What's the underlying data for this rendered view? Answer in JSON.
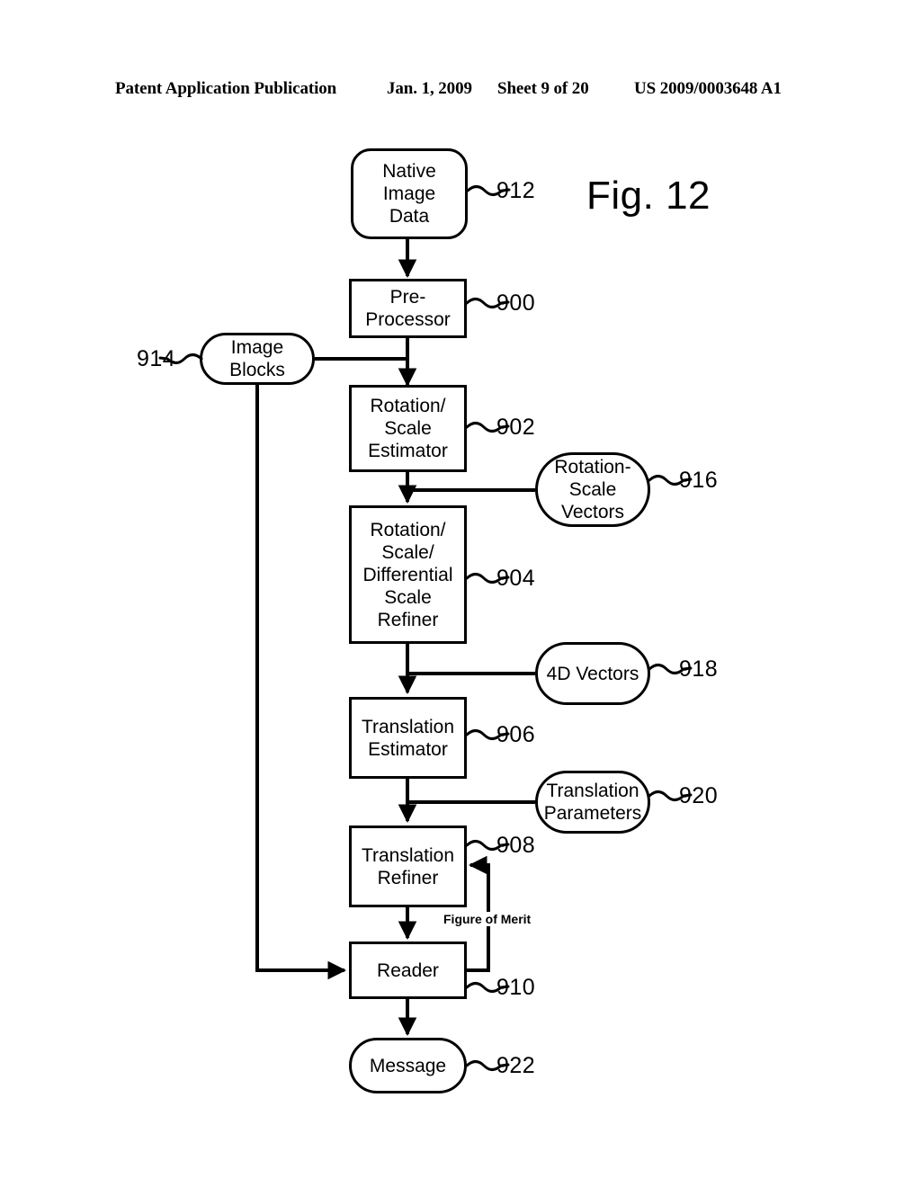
{
  "header": {
    "publication": "Patent Application Publication",
    "date": "Jan. 1, 2009",
    "sheet": "Sheet 9 of 20",
    "patent_number": "US 2009/0003648 A1"
  },
  "figure": {
    "title": "Fig. 12",
    "caption_edge_label": "Figure of Merit"
  },
  "nodes": [
    {
      "id": "n912",
      "ref": "912",
      "label": "Native\nImage\nData",
      "shape": "round"
    },
    {
      "id": "n900",
      "ref": "900",
      "label": "Pre-\nProcessor",
      "shape": "rect"
    },
    {
      "id": "n914",
      "ref": "914",
      "label": "Image\nBlocks",
      "shape": "stadium"
    },
    {
      "id": "n902",
      "ref": "902",
      "label": "Rotation/\nScale\nEstimator",
      "shape": "rect"
    },
    {
      "id": "n916",
      "ref": "916",
      "label": "Rotation-\nScale\nVectors",
      "shape": "stadium"
    },
    {
      "id": "n904",
      "ref": "904",
      "label": "Rotation/\nScale/\nDifferential\nScale\nRefiner",
      "shape": "rect"
    },
    {
      "id": "n918",
      "ref": "918",
      "label": "4D Vectors",
      "shape": "stadium"
    },
    {
      "id": "n906",
      "ref": "906",
      "label": "Translation\nEstimator",
      "shape": "rect"
    },
    {
      "id": "n920",
      "ref": "920",
      "label": "Translation\nParameters",
      "shape": "stadium"
    },
    {
      "id": "n908",
      "ref": "908",
      "label": "Translation\nRefiner",
      "shape": "rect"
    },
    {
      "id": "n910",
      "ref": "910",
      "label": "Reader",
      "shape": "rect"
    },
    {
      "id": "n922",
      "ref": "922",
      "label": "Message",
      "shape": "stadium"
    }
  ],
  "colors": {
    "ink": "#000000",
    "paper": "#ffffff"
  }
}
